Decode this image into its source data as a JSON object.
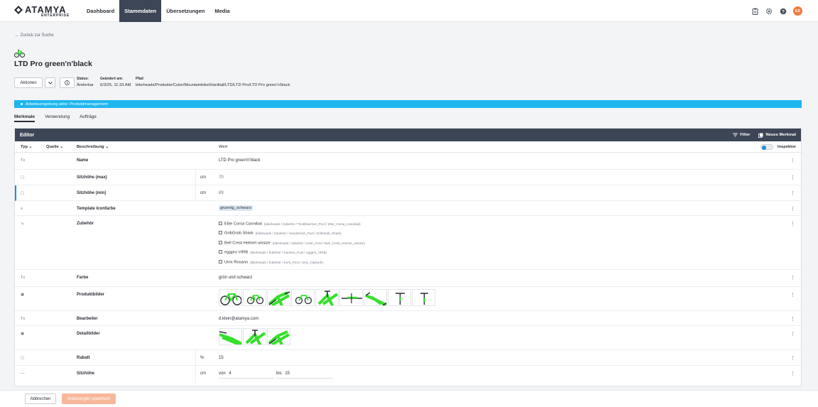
{
  "header": {
    "logo_text": "ATAMYA",
    "logo_sub": "ENTERPRISE",
    "nav": [
      "Dashboard",
      "Stammdaten",
      "Übersetzungen",
      "Media"
    ],
    "avatar": "ES"
  },
  "page": {
    "back": "← Zurück zur Suche",
    "title": "LTD Pro green'n'black",
    "actions_label": "Aktionen",
    "status_label": "Status:",
    "status_value": "Änderbar",
    "changed_label": "Geändert am:",
    "changed_value": "6/3/25, 11:33 AM",
    "path_label": "Pfad",
    "path_value": "bikeheads/Produkte/Cube/Mountainbike/Hardtail/LTD/LTD Pro/LTD Pro green'n'black",
    "banner": "Arbeitsumgebung aktiv: Produktmanagement"
  },
  "tabs": [
    "Merkmale",
    "Verwendung",
    "Aufträge"
  ],
  "editor": {
    "title": "Editor",
    "filter": "Filter",
    "new_feature": "Neues Merkmal",
    "columns": {
      "type": "Typ",
      "source": "Quelle",
      "description": "Beschreibung",
      "value": "Wert",
      "inspector": "Inspektor"
    },
    "rows": {
      "name": {
        "type": "Tx",
        "desc": "Name",
        "value": "LTD Pro green'n'black"
      },
      "seat_max": {
        "type": "▢",
        "desc": "Sitzhöhe (max)",
        "unit": "cm",
        "value": "70"
      },
      "seat_min": {
        "type": "▢",
        "desc": "Sitzhöhe (min)",
        "unit": "cm",
        "value": "89"
      },
      "template": {
        "type": "≡",
        "desc": "Template Iconfarbe",
        "value": "gruen/g_schwarz"
      },
      "accessories": {
        "type": "↘",
        "desc": "Zubehör",
        "items": [
          {
            "name": "Elite Corsa Cannibal",
            "path": "(bikeheads / Zubehör / Trinkflaschen_Pool / Elite_Corsa_Cannibal)"
          },
          {
            "name": "GribGrab Shark",
            "path": "(bikeheads / Zubehör / Handschuh_Pool / GribGrab_Shark)"
          },
          {
            "name": "Bell Crest Helmet unisize",
            "path": "(bikeheads / Zubehör / Helm_Pool / Bell_Crest_Helmet_unisize)"
          },
          {
            "name": "eggpro VIRB",
            "path": "(bikeheads / Zubehör / Kamera_Pool / eggpro_VIRB)"
          },
          {
            "name": "Unix Rosano",
            "path": "(bikeheads / Zubehör / Korb_Pool / Unix_Citykorb)"
          }
        ]
      },
      "color": {
        "type": "Tx",
        "desc": "Farbe",
        "value": "grün und schwarz"
      },
      "product_images": {
        "type": "▣",
        "desc": "Produktbilder"
      },
      "editor_person": {
        "type": "Tx",
        "desc": "Bearbeiter",
        "value": "d.klein@atamya.com"
      },
      "detail_images": {
        "type": "▣",
        "desc": "Detailbilder"
      },
      "discount": {
        "type": "▢",
        "desc": "Rabatt",
        "unit": "%",
        "value": "15"
      },
      "seat_height": {
        "type": "—",
        "desc": "Sitzhöhe",
        "unit": "cm",
        "from_label": "von",
        "from": "4",
        "to_label": "bis",
        "to": "15"
      }
    }
  },
  "footer": {
    "cancel": "Abbrechen",
    "save": "Änderungen speichern"
  },
  "colors": {
    "nav_active": "#3d4656",
    "banner": "#1fb6f0",
    "accent": "#f07b3f",
    "bike_green": "#35e02b"
  }
}
